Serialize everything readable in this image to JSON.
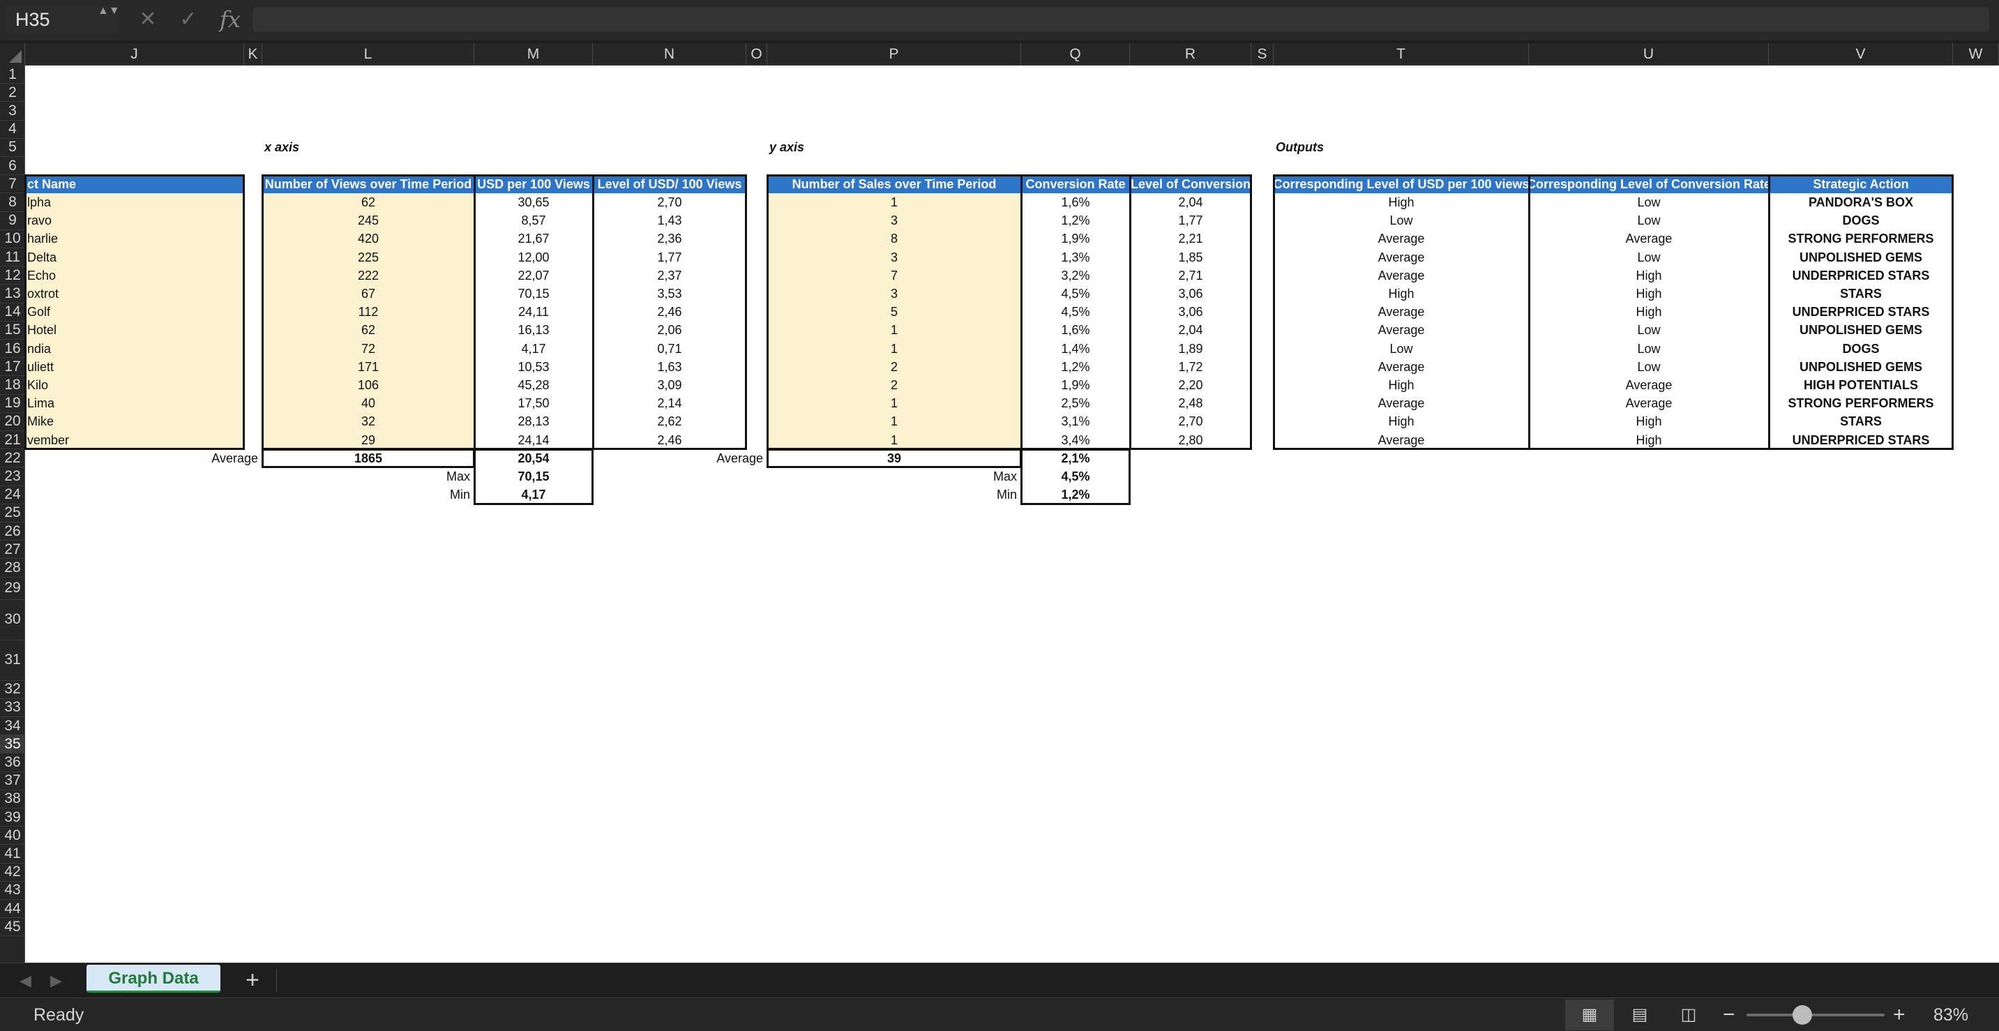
{
  "formula_bar": {
    "name_box": "H35",
    "stepper": "▲▼",
    "cancel_icon": "✕",
    "enter_icon": "✓",
    "fx_label": "fx",
    "formula": ""
  },
  "columns": [
    "J",
    "K",
    "L",
    "M",
    "N",
    "O",
    "P",
    "Q",
    "R",
    "S",
    "T",
    "U",
    "V",
    "W"
  ],
  "rows": [
    "1",
    "2",
    "3",
    "4",
    "5",
    "6",
    "7",
    "8",
    "9",
    "10",
    "11",
    "12",
    "13",
    "14",
    "15",
    "16",
    "17",
    "18",
    "19",
    "20",
    "21",
    "22",
    "23",
    "24",
    "25",
    "26",
    "27",
    "28",
    "29",
    "30",
    "31",
    "32",
    "33",
    "34",
    "35",
    "36",
    "37",
    "38",
    "39",
    "40",
    "41",
    "42",
    "43",
    "44",
    "45"
  ],
  "selected_row": "35",
  "labels": {
    "x_axis": "x axis",
    "y_axis": "y axis",
    "outputs": "Outputs"
  },
  "headers": {
    "product_name": "ct Name",
    "views": "Number of Views over Time Period",
    "usd_per_100": "USD per 100 Views",
    "level_usd": "Level of USD/ 100 Views",
    "sales": "Number of Sales over Time Period",
    "conversion_rate": "Conversion Rate",
    "level_conversion": "Level of Conversion",
    "corr_usd": "Corresponding Level of USD per 100 views",
    "corr_conv": "Corresponding Level of Conversion Rate",
    "strategic_action": "Strategic Action"
  },
  "data_rows": [
    {
      "name": "lpha",
      "views": "62",
      "usd": "30,65",
      "lvl_usd": "2,70",
      "sales": "1",
      "conv": "1,6%",
      "lvl_conv": "2,04",
      "corr_usd": "High",
      "corr_conv": "Low",
      "action": "PANDORA'S BOX"
    },
    {
      "name": "ravo",
      "views": "245",
      "usd": "8,57",
      "lvl_usd": "1,43",
      "sales": "3",
      "conv": "1,2%",
      "lvl_conv": "1,77",
      "corr_usd": "Low",
      "corr_conv": "Low",
      "action": "DOGS"
    },
    {
      "name": "harlie",
      "views": "420",
      "usd": "21,67",
      "lvl_usd": "2,36",
      "sales": "8",
      "conv": "1,9%",
      "lvl_conv": "2,21",
      "corr_usd": "Average",
      "corr_conv": "Average",
      "action": "STRONG PERFORMERS"
    },
    {
      "name": "Delta",
      "views": "225",
      "usd": "12,00",
      "lvl_usd": "1,77",
      "sales": "3",
      "conv": "1,3%",
      "lvl_conv": "1,85",
      "corr_usd": "Average",
      "corr_conv": "Low",
      "action": "UNPOLISHED GEMS"
    },
    {
      "name": "Echo",
      "views": "222",
      "usd": "22,07",
      "lvl_usd": "2,37",
      "sales": "7",
      "conv": "3,2%",
      "lvl_conv": "2,71",
      "corr_usd": "Average",
      "corr_conv": "High",
      "action": "UNDERPRICED STARS"
    },
    {
      "name": "oxtrot",
      "views": "67",
      "usd": "70,15",
      "lvl_usd": "3,53",
      "sales": "3",
      "conv": "4,5%",
      "lvl_conv": "3,06",
      "corr_usd": "High",
      "corr_conv": "High",
      "action": "STARS"
    },
    {
      "name": "Golf",
      "views": "112",
      "usd": "24,11",
      "lvl_usd": "2,46",
      "sales": "5",
      "conv": "4,5%",
      "lvl_conv": "3,06",
      "corr_usd": "Average",
      "corr_conv": "High",
      "action": "UNDERPRICED STARS"
    },
    {
      "name": "Hotel",
      "views": "62",
      "usd": "16,13",
      "lvl_usd": "2,06",
      "sales": "1",
      "conv": "1,6%",
      "lvl_conv": "2,04",
      "corr_usd": "Average",
      "corr_conv": "Low",
      "action": "UNPOLISHED GEMS"
    },
    {
      "name": "ndia",
      "views": "72",
      "usd": "4,17",
      "lvl_usd": "0,71",
      "sales": "1",
      "conv": "1,4%",
      "lvl_conv": "1,89",
      "corr_usd": "Low",
      "corr_conv": "Low",
      "action": "DOGS"
    },
    {
      "name": "uliett",
      "views": "171",
      "usd": "10,53",
      "lvl_usd": "1,63",
      "sales": "2",
      "conv": "1,2%",
      "lvl_conv": "1,72",
      "corr_usd": "Average",
      "corr_conv": "Low",
      "action": "UNPOLISHED GEMS"
    },
    {
      "name": "Kilo",
      "views": "106",
      "usd": "45,28",
      "lvl_usd": "3,09",
      "sales": "2",
      "conv": "1,9%",
      "lvl_conv": "2,20",
      "corr_usd": "High",
      "corr_conv": "Average",
      "action": "HIGH POTENTIALS"
    },
    {
      "name": "Lima",
      "views": "40",
      "usd": "17,50",
      "lvl_usd": "2,14",
      "sales": "1",
      "conv": "2,5%",
      "lvl_conv": "2,48",
      "corr_usd": "Average",
      "corr_conv": "Average",
      "action": "STRONG PERFORMERS"
    },
    {
      "name": "Mike",
      "views": "32",
      "usd": "28,13",
      "lvl_usd": "2,62",
      "sales": "1",
      "conv": "3,1%",
      "lvl_conv": "2,70",
      "corr_usd": "High",
      "corr_conv": "High",
      "action": "STARS"
    },
    {
      "name": "vember",
      "views": "29",
      "usd": "24,14",
      "lvl_usd": "2,46",
      "sales": "1",
      "conv": "3,4%",
      "lvl_conv": "2,80",
      "corr_usd": "Average",
      "corr_conv": "High",
      "action": "UNDERPRICED STARS"
    }
  ],
  "summary": {
    "average_label": "Average",
    "max_label": "Max",
    "min_label": "Min",
    "avg_views": "1865",
    "avg_usd": "20,54",
    "max_usd": "70,15",
    "min_usd": "4,17",
    "avg_sales": "39",
    "avg_conv": "2,1%",
    "max_conv": "4,5%",
    "min_conv": "1,2%"
  },
  "sheet_tabs": {
    "active": "Graph Data",
    "add": "+",
    "prev_icon": "◀",
    "next_icon": "▶"
  },
  "status": {
    "text": "Ready",
    "zoom": "83%",
    "zoom_minus": "−",
    "zoom_plus": "+",
    "view_normal_icon": "▦",
    "view_layout_icon": "▤",
    "view_break_icon": "◫"
  },
  "colors": {
    "header_blue": "#2e75c7",
    "input_yellow": "#fbf1cf",
    "tab_green": "#1e7b3a"
  }
}
